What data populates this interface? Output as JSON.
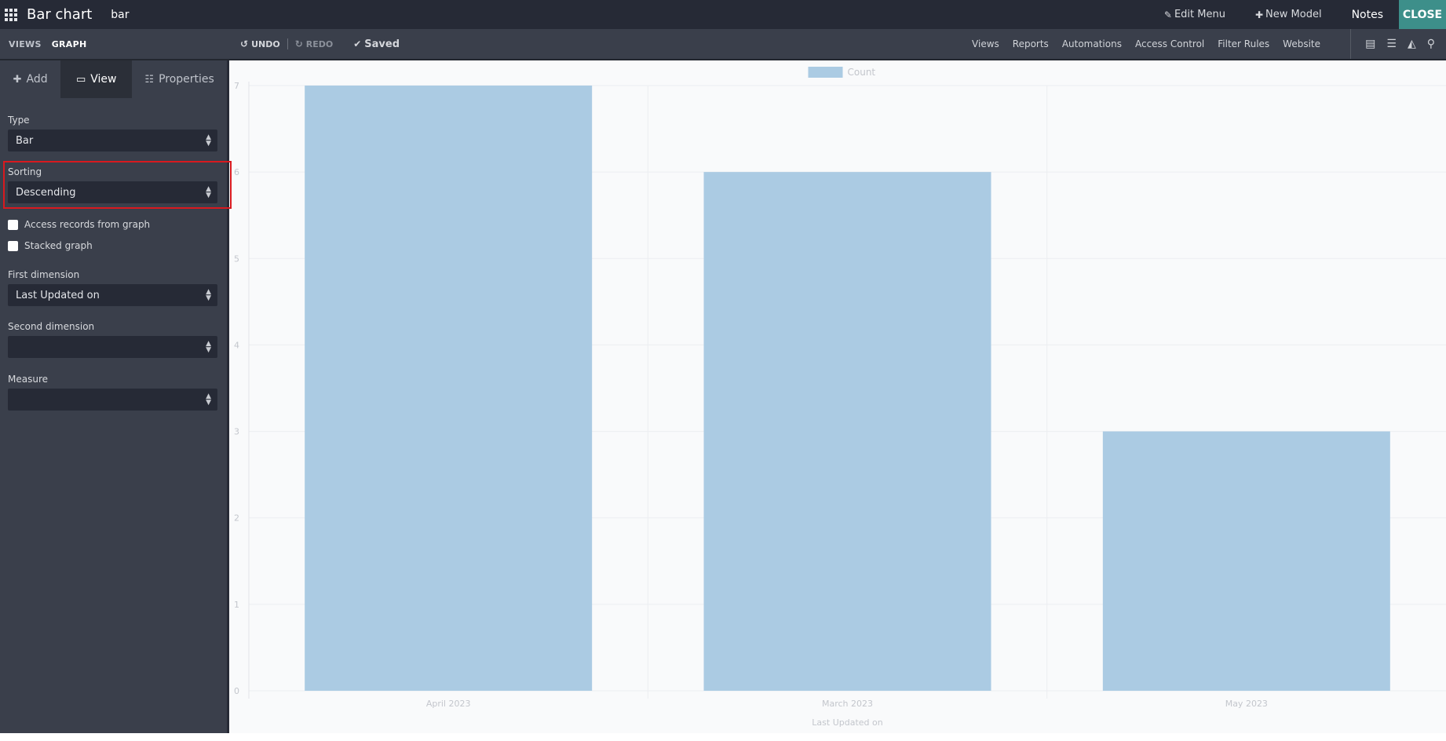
{
  "topbar": {
    "title": "Bar chart",
    "subtitle": "bar",
    "edit_menu": "Edit Menu",
    "new_model": "New Model",
    "notes": "Notes",
    "close": "CLOSE"
  },
  "subbar": {
    "crumb_views": "VIEWS",
    "crumb_graph": "GRAPH",
    "undo": "UNDO",
    "redo": "REDO",
    "saved": "Saved",
    "menu": [
      "Views",
      "Reports",
      "Automations",
      "Access Control",
      "Filter Rules",
      "Website"
    ]
  },
  "sidebar": {
    "tabs": {
      "add": "Add",
      "view": "View",
      "properties": "Properties"
    },
    "type_label": "Type",
    "type_value": "Bar",
    "sorting_label": "Sorting",
    "sorting_value": "Descending",
    "access_records": "Access records from graph",
    "stacked_graph": "Stacked graph",
    "first_dimension_label": "First dimension",
    "first_dimension_value": "Last Updated on",
    "second_dimension_label": "Second dimension",
    "second_dimension_value": "",
    "measure_label": "Measure",
    "measure_value": ""
  },
  "colors": {
    "bar": "#abcbe3",
    "close_button": "#3d8f8a",
    "highlight": "#d8191f"
  },
  "chart_data": {
    "type": "bar",
    "categories": [
      "April 2023",
      "March 2023",
      "May 2023"
    ],
    "series": [
      {
        "name": "Count",
        "values": [
          7,
          6,
          3
        ]
      }
    ],
    "xlabel": "Last Updated on",
    "ylabel": "",
    "ylim": [
      0,
      7
    ],
    "yticks": [
      0,
      1,
      2,
      3,
      4,
      5,
      6,
      7
    ],
    "grid": true,
    "legend": "top-center"
  }
}
